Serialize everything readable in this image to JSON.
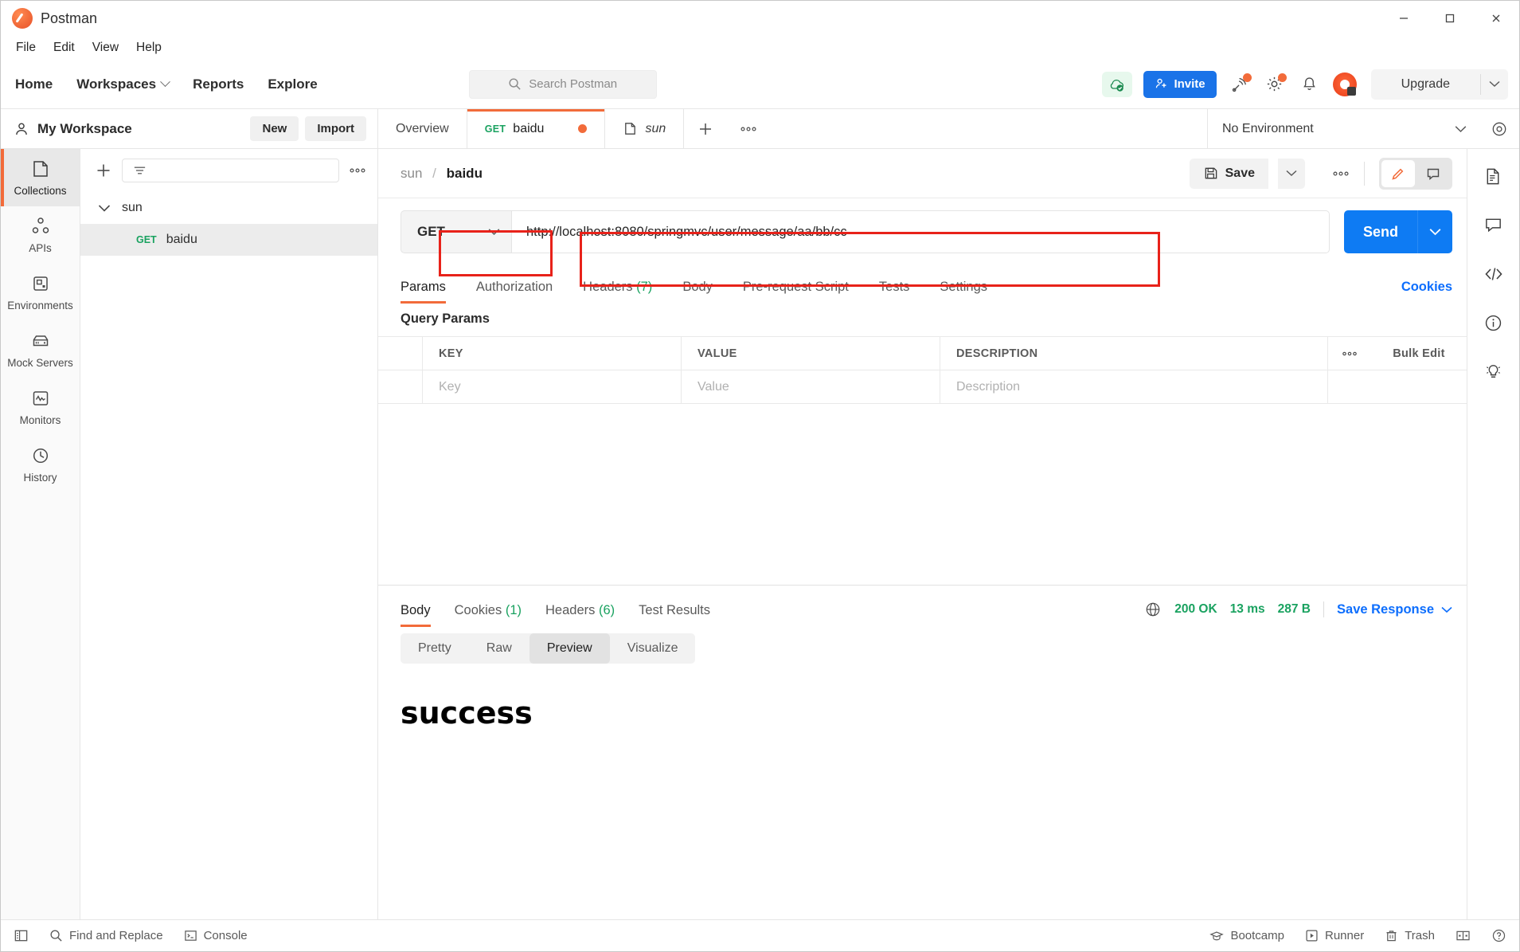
{
  "window": {
    "app_title": "Postman",
    "minimize": "—",
    "maximize": "▢",
    "close": "✕"
  },
  "menubar": [
    "File",
    "Edit",
    "View",
    "Help"
  ],
  "header": {
    "nav": [
      "Home",
      "Workspaces",
      "Reports",
      "Explore"
    ],
    "search_placeholder": "Search Postman",
    "invite_label": "Invite",
    "upgrade_label": "Upgrade"
  },
  "workspace": {
    "name": "My Workspace",
    "new_label": "New",
    "import_label": "Import"
  },
  "tabs": [
    {
      "label": "Overview",
      "method": "",
      "active": false,
      "unsaved": false,
      "doc": false
    },
    {
      "label": "baidu",
      "method": "GET",
      "active": true,
      "unsaved": true,
      "doc": false
    },
    {
      "label": "sun",
      "method": "",
      "active": false,
      "unsaved": false,
      "doc": true
    }
  ],
  "environment": {
    "selected": "No Environment"
  },
  "rail": [
    {
      "label": "Collections",
      "icon": "collections-icon",
      "active": true
    },
    {
      "label": "APIs",
      "icon": "apis-icon",
      "active": false
    },
    {
      "label": "Environments",
      "icon": "environments-icon",
      "active": false
    },
    {
      "label": "Mock Servers",
      "icon": "mock-servers-icon",
      "active": false
    },
    {
      "label": "Monitors",
      "icon": "monitors-icon",
      "active": false
    },
    {
      "label": "History",
      "icon": "history-icon",
      "active": false
    }
  ],
  "sidebar": {
    "filter_placeholder": "",
    "collection": {
      "name": "sun",
      "expanded": true,
      "requests": [
        {
          "method": "GET",
          "name": "baidu",
          "selected": true
        }
      ]
    }
  },
  "request": {
    "breadcrumb_collection": "sun",
    "breadcrumb_name": "baidu",
    "save_label": "Save",
    "method": "GET",
    "url": "http://localhost:8080/springmvc/user/message/aa/bb/cc",
    "send_label": "Send",
    "tabs": [
      {
        "label": "Params",
        "count": "",
        "active": true
      },
      {
        "label": "Authorization",
        "count": "",
        "active": false
      },
      {
        "label": "Headers",
        "count": "(7)",
        "active": false
      },
      {
        "label": "Body",
        "count": "",
        "active": false
      },
      {
        "label": "Pre-request Script",
        "count": "",
        "active": false
      },
      {
        "label": "Tests",
        "count": "",
        "active": false
      },
      {
        "label": "Settings",
        "count": "",
        "active": false
      }
    ],
    "cookies_link": "Cookies",
    "query_params_title": "Query Params",
    "params_table": {
      "headers": [
        "KEY",
        "VALUE",
        "DESCRIPTION"
      ],
      "bulk_edit_label": "Bulk Edit",
      "rows": [
        {
          "key": "Key",
          "value": "Value",
          "description": "Description"
        }
      ]
    }
  },
  "response": {
    "tabs": [
      {
        "label": "Body",
        "count": "",
        "active": true
      },
      {
        "label": "Cookies",
        "count": "(1)",
        "active": false
      },
      {
        "label": "Headers",
        "count": "(6)",
        "active": false
      },
      {
        "label": "Test Results",
        "count": "",
        "active": false
      }
    ],
    "status": "200 OK",
    "time": "13 ms",
    "size": "287 B",
    "save_response_label": "Save Response",
    "formats": [
      {
        "label": "Pretty",
        "active": false
      },
      {
        "label": "Raw",
        "active": false
      },
      {
        "label": "Preview",
        "active": true
      },
      {
        "label": "Visualize",
        "active": false
      }
    ],
    "body_text": "success"
  },
  "statusbar": {
    "left": [
      {
        "label": "Find and Replace",
        "icon": "search-icon"
      },
      {
        "label": "Console",
        "icon": "console-icon"
      }
    ],
    "right": [
      {
        "label": "Bootcamp",
        "icon": "bootcamp-icon"
      },
      {
        "label": "Runner",
        "icon": "runner-icon"
      },
      {
        "label": "Trash",
        "icon": "trash-icon"
      }
    ]
  },
  "colors": {
    "accent_orange": "#f26b3a",
    "blue": "#0e7bf3",
    "green": "#1aa260",
    "highlight_red": "#e8221a"
  }
}
